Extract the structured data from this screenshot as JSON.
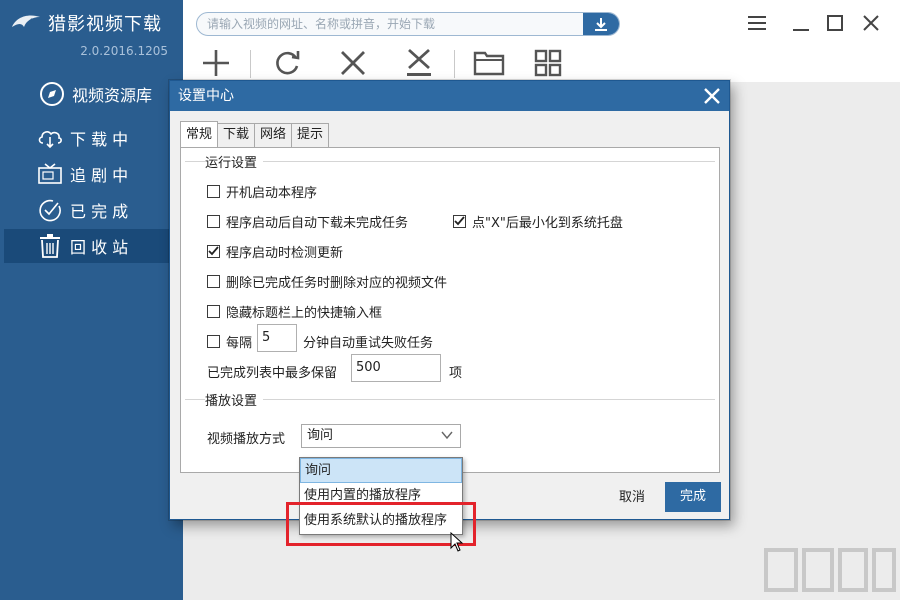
{
  "app": {
    "name": "猎影视频下载",
    "version": "2.0.2016.1205"
  },
  "sidebar": {
    "items": [
      {
        "label": "视频资源库",
        "icon": "compass-icon"
      },
      {
        "label": "下 载 中",
        "icon": "cloud-download-icon"
      },
      {
        "label": "追 剧 中",
        "icon": "tv-icon"
      },
      {
        "label": "已 完 成",
        "icon": "check-circle-icon"
      },
      {
        "label": "回 收 站",
        "icon": "trash-icon",
        "active": true
      }
    ]
  },
  "search": {
    "placeholder": "请输入视频的网址、名称或拼音，开始下载"
  },
  "toolbar": {
    "icons": [
      "add-icon",
      "refresh-icon",
      "delete-icon",
      "delete-all-icon",
      "folder-icon",
      "grid-view-icon"
    ]
  },
  "window_controls": [
    "menu-icon",
    "minimize-icon",
    "maximize-icon",
    "close-icon"
  ],
  "dialog": {
    "title": "设置中心",
    "tabs": [
      {
        "label": "常规",
        "active": true
      },
      {
        "label": "下载"
      },
      {
        "label": "网络"
      },
      {
        "label": "提示"
      }
    ],
    "run_section": {
      "title": "运行设置",
      "autostart": {
        "label": "开机启动本程序",
        "checked": false
      },
      "resume_downloads": {
        "label": "程序启动后自动下载未完成任务",
        "checked": false
      },
      "minimize_to_tray": {
        "label": "点\"X\"后最小化到系统托盘",
        "checked": true
      },
      "check_update": {
        "label": "程序启动时检测更新",
        "checked": true
      },
      "delete_files": {
        "label": "删除已完成任务时删除对应的视频文件",
        "checked": false
      },
      "hide_quick_input": {
        "label": "隐藏标题栏上的快捷输入框",
        "checked": false
      },
      "retry": {
        "label_prefix": "每隔",
        "value": "5",
        "label_suffix": "分钟自动重试失败任务",
        "checked": false
      },
      "keep_completed": {
        "label_prefix": "已完成列表中最多保留",
        "value": "500",
        "label_suffix": "项"
      }
    },
    "play_section": {
      "title": "播放设置",
      "method_label": "视频播放方式",
      "selected": "询问",
      "options": [
        "询问",
        "使用内置的播放程序",
        "使用系统默认的播放程序"
      ]
    },
    "cancel_label": "取消",
    "ok_label": "完成"
  },
  "colors": {
    "sidebar_bg": "#2a5d8f",
    "accent": "#2e6aa3",
    "annotation": "#e3232b"
  }
}
